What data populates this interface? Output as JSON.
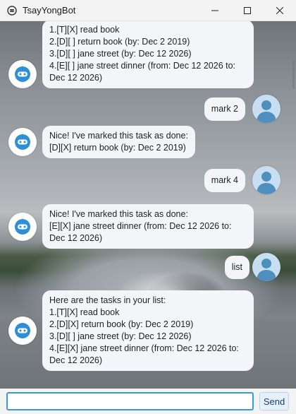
{
  "window": {
    "title": "TsayYongBot",
    "icons": {
      "app": "robot-icon",
      "minimize": "minimize-icon",
      "maximize": "maximize-icon",
      "close": "close-icon"
    }
  },
  "messages": [
    {
      "sender": "bot",
      "text": "1.[T][X] read book\n2.[D][ ] return book (by: Dec 2 2019)\n3.[D][ ] jane street (by: Dec 12 2026)\n4.[E][ ] jane street dinner (from: Dec 12 2026 to: Dec 12 2026)"
    },
    {
      "sender": "user",
      "text": "mark 2"
    },
    {
      "sender": "bot",
      "text": "Nice! I've marked this task as done:\n [D][X] return book (by: Dec 2 2019)"
    },
    {
      "sender": "user",
      "text": "mark 4"
    },
    {
      "sender": "bot",
      "text": "Nice! I've marked this task as done:\n [E][X] jane street dinner (from: Dec 12 2026 to: Dec 12 2026)"
    },
    {
      "sender": "user",
      "text": "list"
    },
    {
      "sender": "bot",
      "text": "Here are the tasks in your list:\n1.[T][X] read book\n2.[D][X] return book (by: Dec 2 2019)\n3.[D][ ] jane street (by: Dec 12 2026)\n4.[E][X] jane street dinner (from: Dec 12 2026 to: Dec 12 2026)"
    }
  ],
  "avatars": {
    "bot": "robot-avatar-icon",
    "user": "user-avatar-icon"
  },
  "input": {
    "value": "",
    "placeholder": ""
  },
  "send_label": "Send",
  "colors": {
    "bubble": "#f4f5f9",
    "user_avatar_bg": "#c8dff2",
    "robot_accent": "#2f8fd6",
    "input_border": "#3c98e0"
  }
}
